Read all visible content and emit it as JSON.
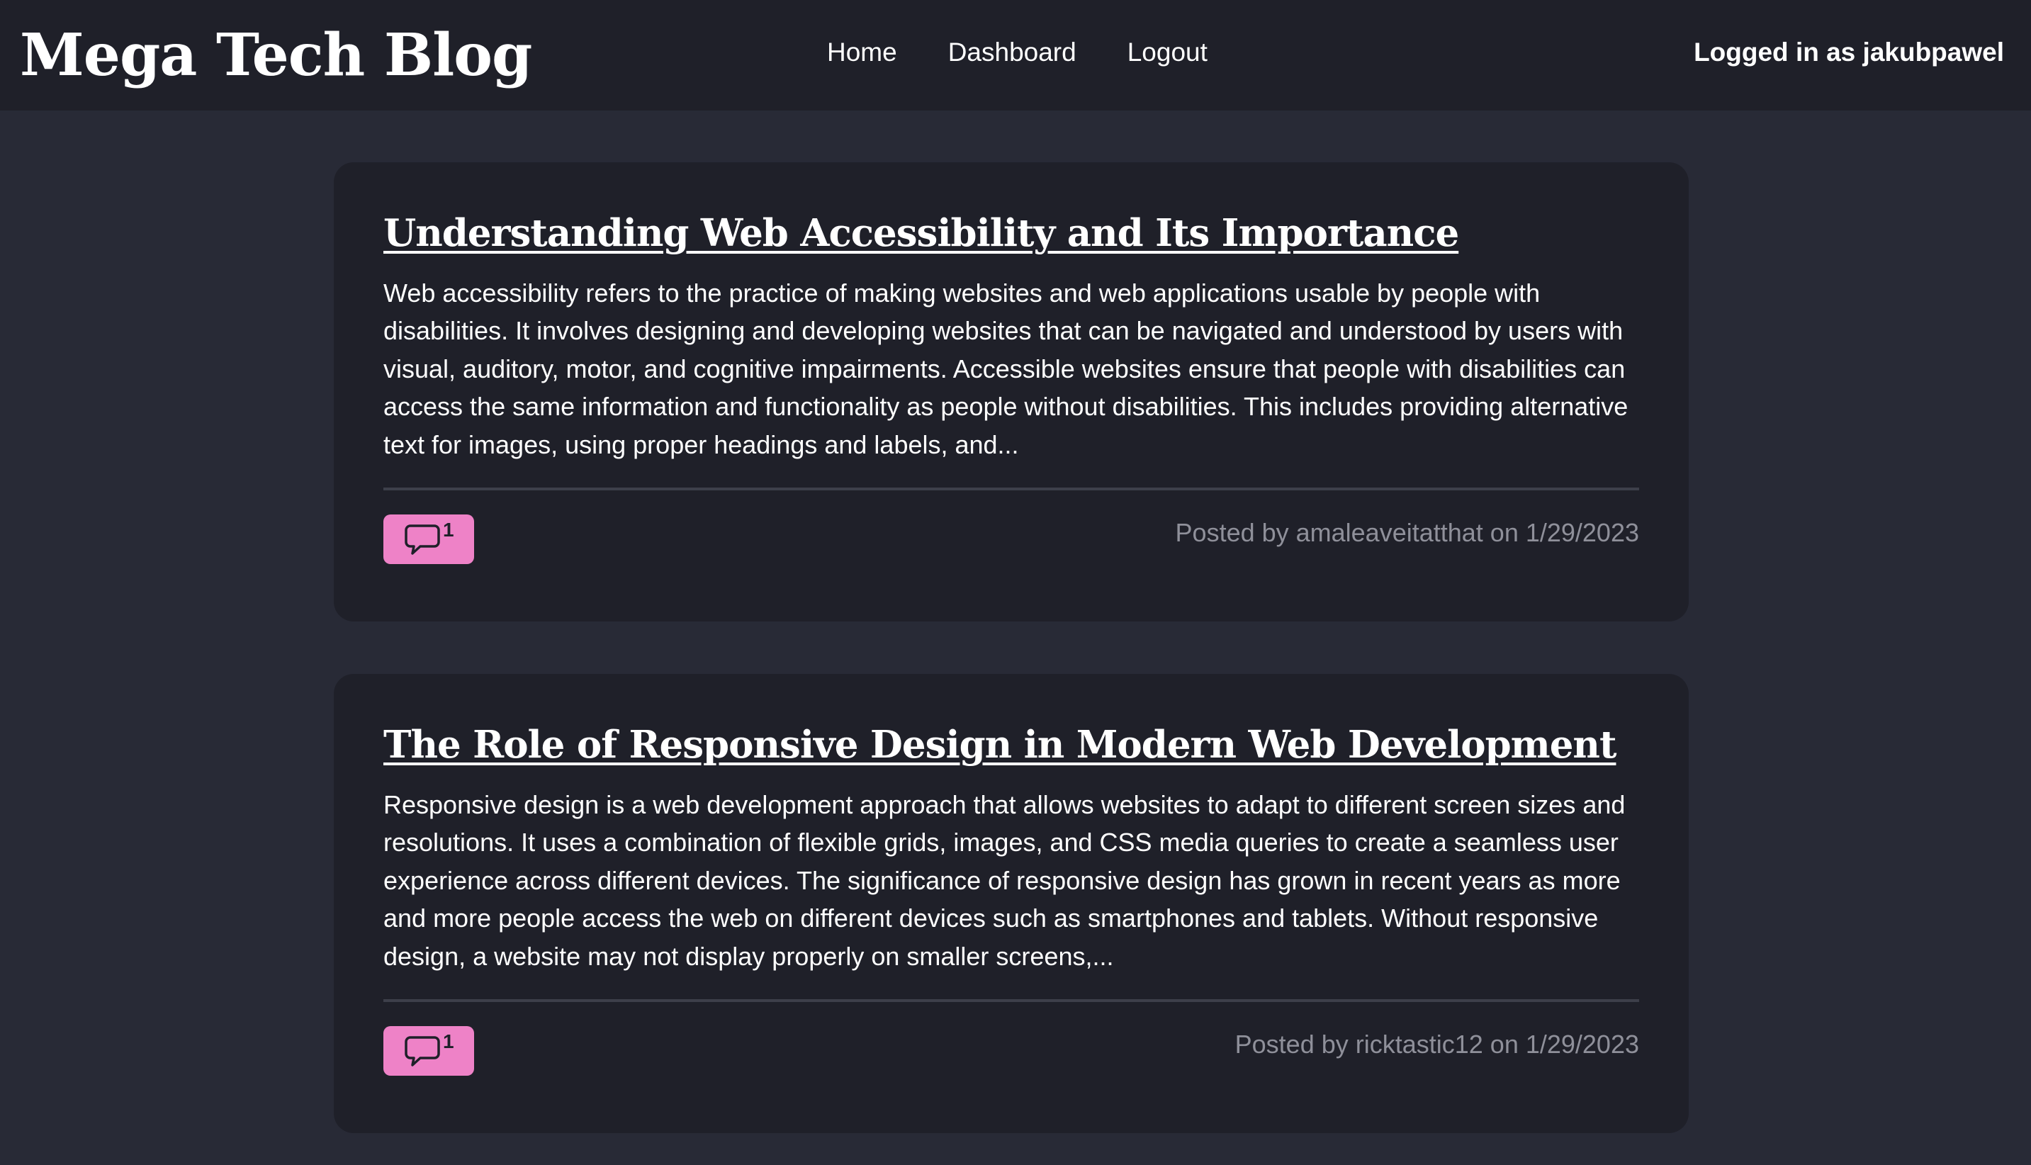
{
  "header": {
    "brand": "Mega Tech Blog",
    "nav": [
      {
        "label": "Home"
      },
      {
        "label": "Dashboard"
      },
      {
        "label": "Logout"
      }
    ],
    "session_label": "Logged in as jakubpawel"
  },
  "posts": [
    {
      "title": "Understanding Web Accessibility and Its Importance",
      "excerpt": "Web accessibility refers to the practice of making websites and web applications usable by people with disabilities. It involves designing and developing websites that can be navigated and understood by users with visual, auditory, motor, and cognitive impairments. Accessible websites ensure that people with disabilities can access the same information and functionality as people without disabilities. This includes providing alternative text for images, using proper headings and labels, and...",
      "comment_count": "1",
      "meta": "Posted by amaleaveitatthat on 1/29/2023"
    },
    {
      "title": "The Role of Responsive Design in Modern Web Development",
      "excerpt": "Responsive design is a web development approach that allows websites to adapt to different screen sizes and resolutions. It uses a combination of flexible grids, images, and CSS media queries to create a seamless user experience across different devices. The significance of responsive design has grown in recent years as more and more people access the web on different devices such as smartphones and tablets. Without responsive design, a website may not display properly on smaller screens,...",
      "comment_count": "1",
      "meta": "Posted by ricktastic12 on 1/29/2023"
    }
  ],
  "icons": {
    "comment": "speech-bubble-icon"
  },
  "colors": {
    "page_bg": "#282a36",
    "surface": "#1f2029",
    "accent": "#ee82c7",
    "muted_text": "#8f909a"
  }
}
